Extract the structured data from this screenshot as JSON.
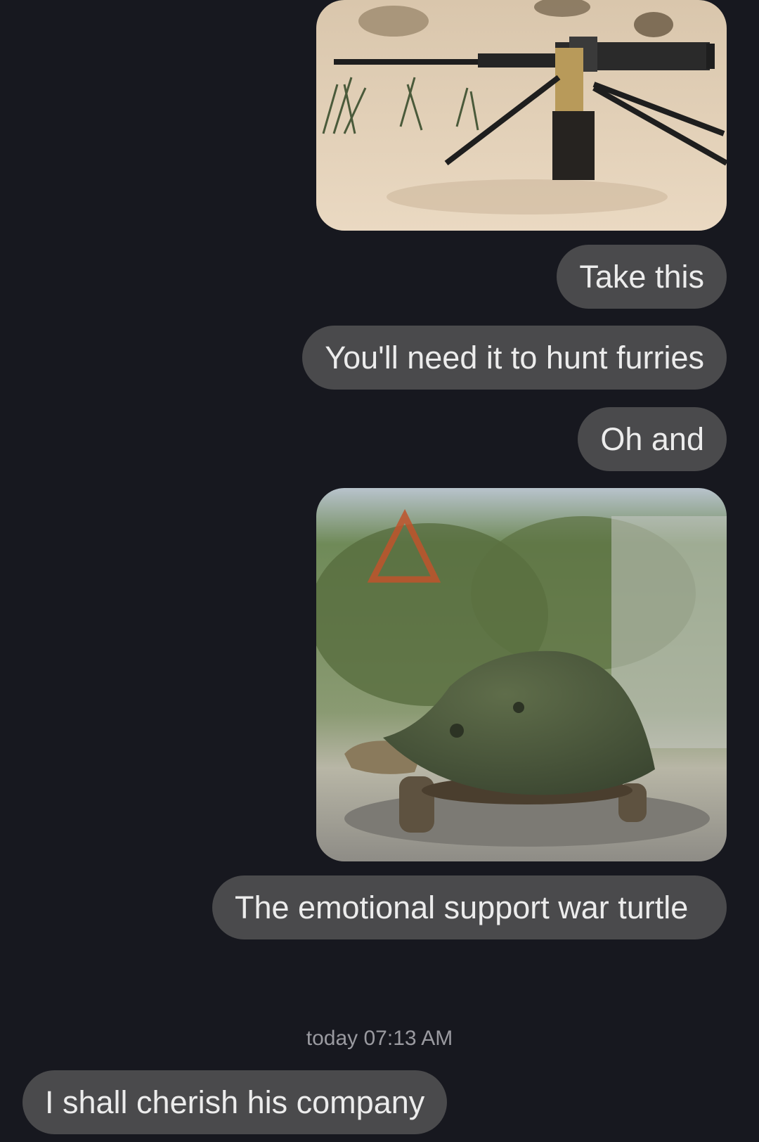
{
  "messages": {
    "take_this": "Take this",
    "hunt_furries": "You'll need it to hunt furries",
    "oh_and": "Oh and",
    "war_turtle": "The emotional support war turtle",
    "cherish": "I shall cherish his company"
  },
  "media": {
    "photo1_icon": "machine-gun-photo",
    "photo2_icon": "helmet-turtle-photo"
  },
  "timestamp": {
    "day": "today",
    "time": "07:13 AM"
  },
  "colors": {
    "background": "#17181f",
    "bubble": "#4a4a4c",
    "text": "#ececec",
    "timestamp": "#9a9aa0"
  }
}
